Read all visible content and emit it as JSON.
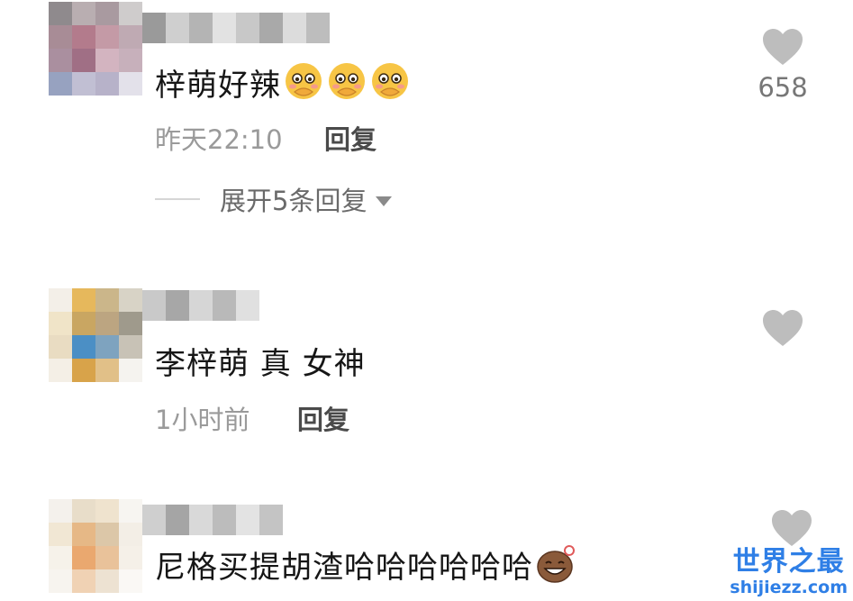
{
  "comments": [
    {
      "text": "梓萌好辣",
      "emoji_count": 3,
      "emoji_name": "covering-mouth-emoji",
      "time": "昨天22:10",
      "reply_label": "回复",
      "expand_label": "展开5条回复",
      "likes": "658"
    },
    {
      "text": "李梓萌 真 女神",
      "time": "1小时前",
      "reply_label": "回复"
    },
    {
      "text": "尼格买提胡渣哈哈哈哈哈哈",
      "emoji_name": "laughing-potato-emoji"
    }
  ],
  "icons": {
    "like": "heart-icon",
    "expand": "triangle-down-icon"
  },
  "colors": {
    "heart": "#bdbdbd",
    "text": "#161616",
    "meta": "#9a9a9a",
    "reply": "#4a4a4a",
    "watermark": "#2f7fe6"
  },
  "watermark": {
    "title": "世界之最",
    "url": "shijiezz.com"
  }
}
